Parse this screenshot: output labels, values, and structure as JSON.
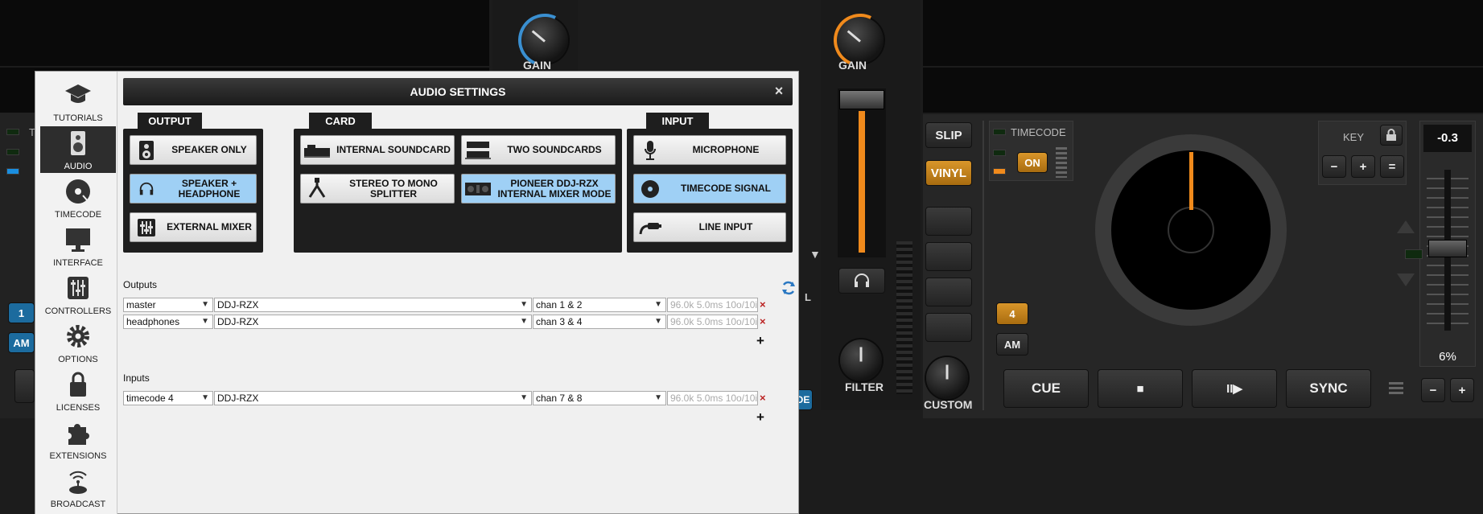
{
  "deck_left": {
    "gain_label": "GAIN",
    "deck_num": "1",
    "am_label": "AM",
    "t_label": "T"
  },
  "mixer": {
    "gain_label": "GAIN",
    "filter_label": "FILTER",
    "custom_label": "CUSTOM",
    "l_label": "L",
    "de_label": "DE",
    "arrow": "▼"
  },
  "deck_right": {
    "slip": "SLIP",
    "vinyl": "VINYL",
    "timecode": "TIMECODE",
    "on": "ON",
    "key_label": "KEY",
    "pitch_value": "-0.3",
    "pitch_range": "6%",
    "deck_num": "4",
    "am_label": "AM",
    "cue": "CUE",
    "stop": "■",
    "play": "II▶",
    "sync": "SYNC",
    "minus": "−",
    "plus": "+",
    "equal": "="
  },
  "dialog": {
    "title": "AUDIO SETTINGS",
    "close": "×",
    "sidebar": [
      {
        "label": "TUTORIALS",
        "icon": "graduation-cap-icon"
      },
      {
        "label": "AUDIO",
        "icon": "speaker-icon"
      },
      {
        "label": "TIMECODE",
        "icon": "vinyl-record-icon"
      },
      {
        "label": "INTERFACE",
        "icon": "monitor-icon"
      },
      {
        "label": "CONTROLLERS",
        "icon": "sliders-icon"
      },
      {
        "label": "OPTIONS",
        "icon": "gear-icon"
      },
      {
        "label": "LICENSES",
        "icon": "lock-icon"
      },
      {
        "label": "EXTENSIONS",
        "icon": "puzzle-icon"
      },
      {
        "label": "BROADCAST",
        "icon": "broadcast-icon"
      }
    ],
    "groups": {
      "output": {
        "label": "OUTPUT",
        "options": [
          "SPEAKER ONLY",
          "SPEAKER + HEADPHONE",
          "EXTERNAL MIXER"
        ]
      },
      "card": {
        "label": "CARD",
        "options": [
          "INTERNAL SOUNDCARD",
          "TWO SOUNDCARDS",
          "STEREO TO MONO SPLITTER",
          "PIONEER DDJ-RZX INTERNAL MIXER MODE"
        ]
      },
      "input": {
        "label": "INPUT",
        "options": [
          "MICROPHONE",
          "TIMECODE SIGNAL",
          "LINE INPUT"
        ]
      }
    },
    "outputs_label": "Outputs",
    "outputs": [
      {
        "name": "master",
        "device": "DDJ-RZX",
        "channel": "chan 1 & 2",
        "info": "96.0k 5.0ms 10o/10i"
      },
      {
        "name": "headphones",
        "device": "DDJ-RZX",
        "channel": "chan 3 & 4",
        "info": "96.0k 5.0ms 10o/10i"
      }
    ],
    "inputs_label": "Inputs",
    "inputs": [
      {
        "name": "timecode 4",
        "device": "DDJ-RZX",
        "channel": "chan 7 & 8",
        "info": "96.0k 5.0ms 10o/10i"
      }
    ],
    "remove": "×",
    "add": "+"
  },
  "colors": {
    "accent_blue": "#9fd0f5",
    "orange": "#f08a1c",
    "deck_blue": "#3a8fd0"
  }
}
